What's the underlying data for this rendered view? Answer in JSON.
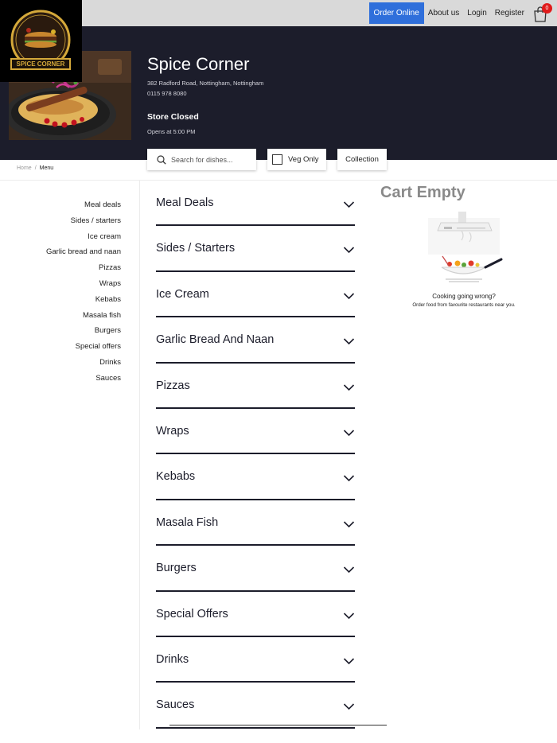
{
  "nav": {
    "order_online": "Order Online",
    "about_us": "About us",
    "login": "Login",
    "register": "Register",
    "cart_count": "0"
  },
  "logo": {
    "text": "SPICE CORNER"
  },
  "store": {
    "name": "Spice Corner",
    "address": "382 Radford Road, Nottingham, Nottingham",
    "phone": "0115 978 8080",
    "status": "Store Closed",
    "opens": "Opens at 5:00 PM"
  },
  "filters": {
    "search_placeholder": "Search for dishes...",
    "veg_only": "Veg Only",
    "veg_checked": false,
    "collection": "Collection"
  },
  "breadcrumb": {
    "home": "Home",
    "separator": "/",
    "current": "Menu"
  },
  "sidebar": {
    "items": [
      "Meal deals",
      "Sides / starters",
      "Ice cream",
      "Garlic bread and naan",
      "Pizzas",
      "Wraps",
      "Kebabs",
      "Masala fish",
      "Burgers",
      "Special offers",
      "Drinks",
      "Sauces"
    ]
  },
  "categories": [
    "Meal Deals",
    "Sides / Starters",
    "Ice Cream",
    "Garlic Bread And Naan",
    "Pizzas",
    "Wraps",
    "Kebabs",
    "Masala Fish",
    "Burgers",
    "Special Offers",
    "Drinks",
    "Sauces"
  ],
  "cart": {
    "title": "Cart Empty",
    "message": "Cooking going wrong?",
    "sub": "Order food from favourite restaurants near you."
  },
  "colors": {
    "hero_bg": "#1c1d2b",
    "nav_bg": "#d9d9d9",
    "accent": "#2f6fdb",
    "badge": "#e01b1b",
    "logo_gold": "#d4a83a"
  },
  "icons": {
    "search": "search-icon",
    "cart": "shopping-bag-icon",
    "chevron": "chevron-down-icon"
  }
}
